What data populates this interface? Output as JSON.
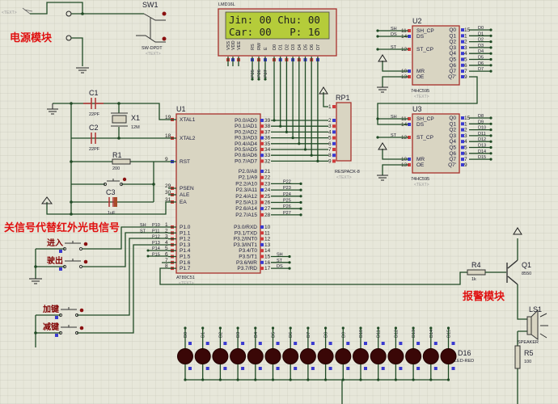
{
  "labels": {
    "power_module": "电源模块",
    "signal_note": "关信号代替红外光电信号",
    "alarm_module": "报警模块",
    "text_placeholder": "<TEXT>"
  },
  "sw1": {
    "ref": "SW1",
    "part": "SW-DPDT"
  },
  "lcd": {
    "ref": "LMD16L",
    "line1": "Jin: 00 Chu: 00",
    "line2": "Car: 00   P: 16",
    "pins": [
      "VSS",
      "VDD",
      "VEE",
      "RS",
      "RW",
      "E",
      "D0",
      "D1",
      "D2",
      "D3",
      "D4",
      "D5",
      "D6",
      "D7"
    ],
    "nets": [
      "P25",
      "P26",
      "P27"
    ],
    "screen_color": "#b5cc3a"
  },
  "c1": {
    "ref": "C1",
    "value": "22PF"
  },
  "c2": {
    "ref": "C2",
    "value": "22PF"
  },
  "x1": {
    "ref": "X1",
    "value": "12M"
  },
  "r1": {
    "ref": "R1",
    "value": "200"
  },
  "c3": {
    "ref": "C3",
    "value": "1uF"
  },
  "u1": {
    "ref": "U1",
    "part": "AT89C51",
    "left_pins": [
      {
        "num": "19",
        "name": "XTAL1"
      },
      {
        "num": "18",
        "name": "XTAL2"
      },
      {
        "num": "9",
        "name": "RST"
      },
      {
        "num": "29",
        "name": "PSEN"
      },
      {
        "num": "30",
        "name": "ALE"
      },
      {
        "num": "31",
        "name": "EA"
      },
      {
        "num": "1",
        "name": "P1.0"
      },
      {
        "num": "2",
        "name": "P1.1"
      },
      {
        "num": "3",
        "name": "P1.2"
      },
      {
        "num": "4",
        "name": "P1.3"
      },
      {
        "num": "5",
        "name": "P1.4"
      },
      {
        "num": "6",
        "name": "P1.5"
      },
      {
        "num": "7",
        "name": "P1.6"
      },
      {
        "num": "8",
        "name": "P1.7"
      }
    ],
    "p0_pins": [
      {
        "num": "39",
        "name": "P0.0/AD0"
      },
      {
        "num": "38",
        "name": "P0.1/AD1"
      },
      {
        "num": "37",
        "name": "P0.2/AD2"
      },
      {
        "num": "36",
        "name": "P0.3/AD3"
      },
      {
        "num": "35",
        "name": "P0.4/AD4"
      },
      {
        "num": "34",
        "name": "P0.5/AD5"
      },
      {
        "num": "33",
        "name": "P0.6/AD6"
      },
      {
        "num": "32",
        "name": "P0.7/AD7"
      }
    ],
    "p2_pins": [
      {
        "num": "21",
        "name": "P2.0/A8"
      },
      {
        "num": "22",
        "name": "P2.1/A9"
      },
      {
        "num": "23",
        "name": "P2.2/A10"
      },
      {
        "num": "24",
        "name": "P2.3/A11"
      },
      {
        "num": "25",
        "name": "P2.4/A12"
      },
      {
        "num": "26",
        "name": "P2.5/A13"
      },
      {
        "num": "27",
        "name": "P2.6/A14"
      },
      {
        "num": "28",
        "name": "P2.7/A15"
      }
    ],
    "p3_pins": [
      {
        "num": "10",
        "name": "P3.0/RXD"
      },
      {
        "num": "11",
        "name": "P3.1/TXD"
      },
      {
        "num": "12",
        "name": "P3.2/INT0"
      },
      {
        "num": "13",
        "name": "P3.3/INT1"
      },
      {
        "num": "14",
        "name": "P3.4/T0"
      },
      {
        "num": "15",
        "name": "P3.5/T1"
      },
      {
        "num": "16",
        "name": "P3.6/WR"
      },
      {
        "num": "17",
        "name": "P3.7/RD"
      }
    ],
    "p2_nets": [
      "P22",
      "P23",
      "P24",
      "P25",
      "P26",
      "P27"
    ],
    "p3_nets": [
      "SH",
      "ST",
      "DS"
    ],
    "p1_nets": [
      [
        "SH",
        "P10"
      ],
      [
        "ST",
        "P11"
      ],
      [
        "",
        "P12"
      ],
      [
        "",
        "P13"
      ],
      [
        "",
        "P14"
      ],
      [
        "",
        "P15"
      ]
    ]
  },
  "rp1": {
    "ref": "RP1",
    "part": "RESPACK-8",
    "pins": [
      "1",
      "2",
      "3",
      "4",
      "5",
      "6",
      "7",
      "8",
      "9"
    ]
  },
  "shift_registers": [
    {
      "ref": "U2",
      "part": "74HC595",
      "nets_out": [
        "D0",
        "D1",
        "D2",
        "D3",
        "D4",
        "D5",
        "D6",
        "D7"
      ]
    },
    {
      "ref": "U3",
      "part": "74HC595",
      "nets_out": [
        "D8",
        "D9",
        "D10",
        "D11",
        "D12",
        "D13",
        "D14",
        "D15"
      ]
    }
  ],
  "hc595": {
    "left_pins": [
      {
        "num": "11",
        "name": "SH_CP"
      },
      {
        "num": "14",
        "name": "DS"
      },
      {
        "num": "12",
        "name": "ST_CP"
      },
      {
        "num": "10",
        "name": "MR"
      },
      {
        "num": "13",
        "name": "OE"
      }
    ],
    "right_pins": [
      {
        "num": "15",
        "name": "Q0"
      },
      {
        "num": "1",
        "name": "Q1"
      },
      {
        "num": "2",
        "name": "Q2"
      },
      {
        "num": "3",
        "name": "Q3"
      },
      {
        "num": "4",
        "name": "Q4"
      },
      {
        "num": "5",
        "name": "Q5"
      },
      {
        "num": "6",
        "name": "Q6"
      },
      {
        "num": "7",
        "name": "Q7"
      },
      {
        "num": "9",
        "name": "Q7'"
      }
    ],
    "in_nets": [
      "SH",
      "DS",
      "ST"
    ]
  },
  "buttons": [
    "进入",
    "驶出",
    "加键",
    "减键"
  ],
  "leds": {
    "nets": [
      "D0",
      "D1",
      "D2",
      "D3",
      "D4",
      "D5",
      "D6",
      "D7",
      "D8",
      "D9",
      "D10",
      "D11",
      "D12",
      "D13",
      "D14",
      "D15"
    ],
    "ref": "D16",
    "part": "LED-RED",
    "color": "#3a0707"
  },
  "r4": {
    "ref": "R4",
    "value": "1k"
  },
  "q1": {
    "ref": "Q1",
    "part": "8550"
  },
  "ls1": {
    "ref": "LS1",
    "part": "SPEAKER"
  },
  "r5": {
    "ref": "R5",
    "value": "100"
  }
}
